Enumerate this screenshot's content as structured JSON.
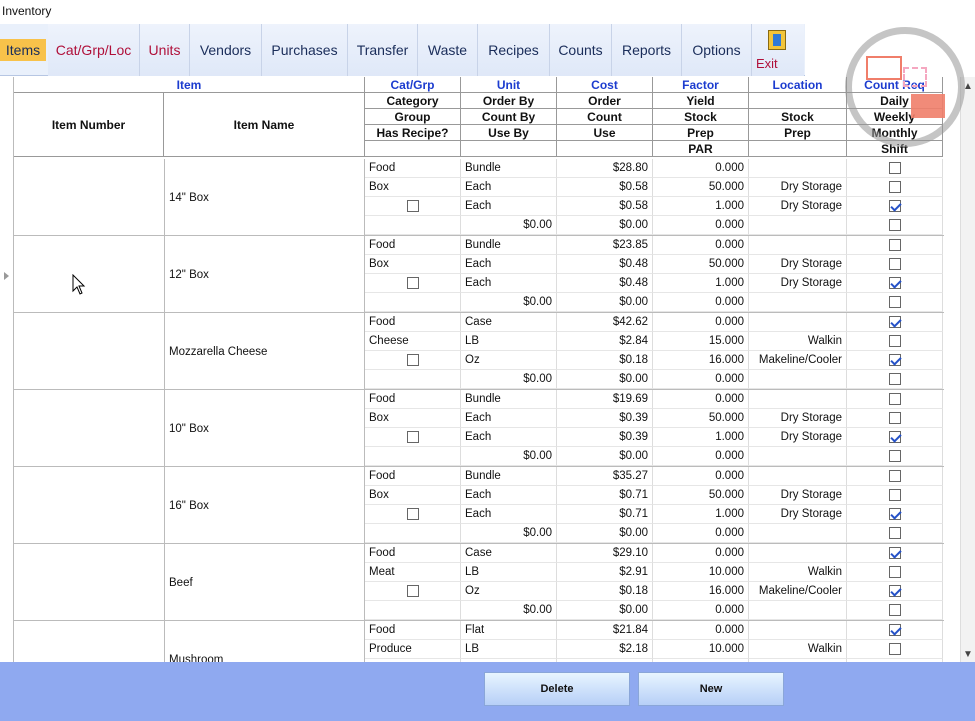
{
  "window": {
    "title": "Inventory"
  },
  "toolbar": {
    "tabs": [
      {
        "label": "Items"
      },
      {
        "label": "Cat/Grp/Loc"
      },
      {
        "label": "Units"
      },
      {
        "label": "Vendors"
      },
      {
        "label": "Purchases"
      },
      {
        "label": "Transfer"
      },
      {
        "label": "Waste"
      },
      {
        "label": "Recipes"
      },
      {
        "label": "Counts"
      },
      {
        "label": "Reports"
      },
      {
        "label": "Options"
      }
    ],
    "exit_label": "Exit"
  },
  "header": {
    "item": "Item",
    "item_number": "Item Number",
    "item_name": "Item Name",
    "catgrp": [
      "Cat/Grp",
      "Category",
      "Group",
      "Has Recipe?",
      ""
    ],
    "unit": [
      "Unit",
      "Order By",
      "Count By",
      "Use By",
      ""
    ],
    "cost": [
      "Cost",
      "Order",
      "Count",
      "Use",
      ""
    ],
    "factor": [
      "Factor",
      "Yield",
      "Stock",
      "Prep",
      "PAR"
    ],
    "location": [
      "Location",
      "",
      "Stock",
      "Prep",
      ""
    ],
    "countreq": [
      "Count Req",
      "Daily",
      "Weekly",
      "Monthly",
      "Shift"
    ]
  },
  "items": [
    {
      "name": "14\" Box",
      "rows": [
        {
          "cg": "Food",
          "unit": "Bundle",
          "cost": "$28.80",
          "factor": "0.000",
          "loc": "",
          "chk": false
        },
        {
          "cg": "Box",
          "unit": "Each",
          "cost": "$0.58",
          "factor": "50.000",
          "loc": "Dry Storage",
          "chk": false
        },
        {
          "cg": "",
          "unit": "Each",
          "cost": "$0.58",
          "factor": "1.000",
          "loc": "Dry Storage",
          "chk": true
        },
        {
          "cg": "",
          "unit": "$0.00",
          "cost": "$0.00",
          "factor": "0.000",
          "loc": "",
          "chk": false
        }
      ]
    },
    {
      "name": "12\" Box",
      "rows": [
        {
          "cg": "Food",
          "unit": "Bundle",
          "cost": "$23.85",
          "factor": "0.000",
          "loc": "",
          "chk": false
        },
        {
          "cg": "Box",
          "unit": "Each",
          "cost": "$0.48",
          "factor": "50.000",
          "loc": "Dry Storage",
          "chk": false
        },
        {
          "cg": "",
          "unit": "Each",
          "cost": "$0.48",
          "factor": "1.000",
          "loc": "Dry Storage",
          "chk": true
        },
        {
          "cg": "",
          "unit": "$0.00",
          "cost": "$0.00",
          "factor": "0.000",
          "loc": "",
          "chk": false
        }
      ]
    },
    {
      "name": "Mozzarella Cheese",
      "rows": [
        {
          "cg": "Food",
          "unit": "Case",
          "cost": "$42.62",
          "factor": "0.000",
          "loc": "",
          "chk": true
        },
        {
          "cg": "Cheese",
          "unit": "LB",
          "cost": "$2.84",
          "factor": "15.000",
          "loc": "Walkin",
          "chk": false
        },
        {
          "cg": "",
          "unit": "Oz",
          "cost": "$0.18",
          "factor": "16.000",
          "loc": "Makeline/Cooler",
          "chk": true
        },
        {
          "cg": "",
          "unit": "$0.00",
          "cost": "$0.00",
          "factor": "0.000",
          "loc": "",
          "chk": false
        }
      ]
    },
    {
      "name": "10\" Box",
      "rows": [
        {
          "cg": "Food",
          "unit": "Bundle",
          "cost": "$19.69",
          "factor": "0.000",
          "loc": "",
          "chk": false
        },
        {
          "cg": "Box",
          "unit": "Each",
          "cost": "$0.39",
          "factor": "50.000",
          "loc": "Dry Storage",
          "chk": false
        },
        {
          "cg": "",
          "unit": "Each",
          "cost": "$0.39",
          "factor": "1.000",
          "loc": "Dry Storage",
          "chk": true
        },
        {
          "cg": "",
          "unit": "$0.00",
          "cost": "$0.00",
          "factor": "0.000",
          "loc": "",
          "chk": false
        }
      ]
    },
    {
      "name": "16\" Box",
      "rows": [
        {
          "cg": "Food",
          "unit": "Bundle",
          "cost": "$35.27",
          "factor": "0.000",
          "loc": "",
          "chk": false
        },
        {
          "cg": "Box",
          "unit": "Each",
          "cost": "$0.71",
          "factor": "50.000",
          "loc": "Dry Storage",
          "chk": false
        },
        {
          "cg": "",
          "unit": "Each",
          "cost": "$0.71",
          "factor": "1.000",
          "loc": "Dry Storage",
          "chk": true
        },
        {
          "cg": "",
          "unit": "$0.00",
          "cost": "$0.00",
          "factor": "0.000",
          "loc": "",
          "chk": false
        }
      ]
    },
    {
      "name": "Beef",
      "rows": [
        {
          "cg": "Food",
          "unit": "Case",
          "cost": "$29.10",
          "factor": "0.000",
          "loc": "",
          "chk": true
        },
        {
          "cg": "Meat",
          "unit": "LB",
          "cost": "$2.91",
          "factor": "10.000",
          "loc": "Walkin",
          "chk": false
        },
        {
          "cg": "",
          "unit": "Oz",
          "cost": "$0.18",
          "factor": "16.000",
          "loc": "Makeline/Cooler",
          "chk": true
        },
        {
          "cg": "",
          "unit": "$0.00",
          "cost": "$0.00",
          "factor": "0.000",
          "loc": "",
          "chk": false
        }
      ]
    },
    {
      "name": "Mushroom",
      "rows": [
        {
          "cg": "Food",
          "unit": "Flat",
          "cost": "$21.84",
          "factor": "0.000",
          "loc": "",
          "chk": true
        },
        {
          "cg": "Produce",
          "unit": "LB",
          "cost": "$2.18",
          "factor": "10.000",
          "loc": "Walkin",
          "chk": false
        },
        {
          "cg": "",
          "unit": "",
          "cost": "",
          "factor": "",
          "loc": "",
          "chk": false
        },
        {
          "cg": "",
          "unit": "",
          "cost": "",
          "factor": "",
          "loc": "",
          "chk": false
        }
      ]
    }
  ],
  "footer": {
    "delete_label": "Delete",
    "new_label": "New"
  }
}
